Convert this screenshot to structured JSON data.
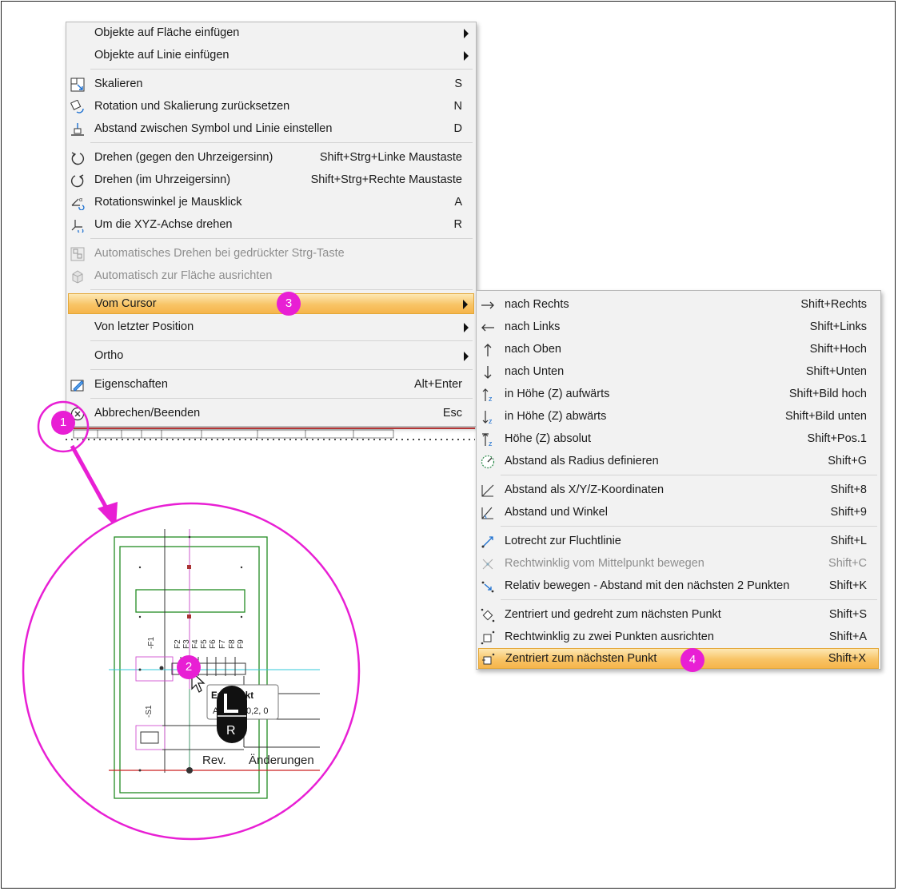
{
  "colors": {
    "menu_bg": "#f2f2f2",
    "highlight": "#f8c466",
    "badge": "#e81fd4",
    "disabled_text": "#8e8e8e"
  },
  "main_menu": {
    "items": [
      {
        "label": "Objekte auf Fläche einfügen",
        "shortcut": "",
        "icon": "none"
      },
      {
        "label": "Objekte auf Linie einfügen",
        "shortcut": "",
        "icon": "none"
      },
      {
        "label": "Skalieren",
        "shortcut": "S",
        "icon": "scale-icon"
      },
      {
        "label": "Rotation und Skalierung zurücksetzen",
        "shortcut": "N",
        "icon": "reset-rotation-icon"
      },
      {
        "label": "Abstand zwischen Symbol und Linie einstellen",
        "shortcut": "D",
        "icon": "symbol-line-distance-icon"
      },
      {
        "label": "Drehen (gegen den Uhrzeigersinn)",
        "shortcut": "Shift+Strg+Linke Maustaste",
        "icon": "rotate-ccw-icon"
      },
      {
        "label": "Drehen (im Uhrzeigersinn)",
        "shortcut": "Shift+Strg+Rechte Maustaste",
        "icon": "rotate-cw-icon"
      },
      {
        "label": "Rotationswinkel je Mausklick",
        "shortcut": "A",
        "icon": "rotation-angle-icon"
      },
      {
        "label": "Um die XYZ-Achse drehen",
        "shortcut": "R",
        "icon": "xyz-rotate-icon"
      },
      {
        "label": "Automatisches Drehen bei gedrückter Strg-Taste",
        "shortcut": "",
        "icon": "auto-rotate-icon"
      },
      {
        "label": "Automatisch zur Fläche ausrichten",
        "shortcut": "",
        "icon": "align-surface-icon"
      },
      {
        "label": "Vom Cursor",
        "shortcut": "",
        "icon": "none"
      },
      {
        "label": "Von letzter Position",
        "shortcut": "",
        "icon": "none"
      },
      {
        "label": "Ortho",
        "shortcut": "",
        "icon": "none"
      },
      {
        "label": "Eigenschaften",
        "shortcut": "Alt+Enter",
        "icon": "properties-icon"
      },
      {
        "label": "Abbrechen/Beenden",
        "shortcut": "Esc",
        "icon": "cancel-icon"
      }
    ]
  },
  "sub_menu": {
    "items": [
      {
        "label": "nach Rechts",
        "shortcut": "Shift+Rechts",
        "icon": "arrow-right-icon"
      },
      {
        "label": "nach Links",
        "shortcut": "Shift+Links",
        "icon": "arrow-left-icon"
      },
      {
        "label": "nach Oben",
        "shortcut": "Shift+Hoch",
        "icon": "arrow-up-icon"
      },
      {
        "label": "nach Unten",
        "shortcut": "Shift+Unten",
        "icon": "arrow-down-icon"
      },
      {
        "label": "in Höhe (Z) aufwärts",
        "shortcut": "Shift+Bild hoch",
        "icon": "z-up-icon"
      },
      {
        "label": "in Höhe (Z) abwärts",
        "shortcut": "Shift+Bild unten",
        "icon": "z-down-icon"
      },
      {
        "label": "Höhe (Z) absolut",
        "shortcut": "Shift+Pos.1",
        "icon": "z-absolute-icon"
      },
      {
        "label": "Abstand als Radius definieren",
        "shortcut": "Shift+G",
        "icon": "radius-icon"
      },
      {
        "label": "Abstand als X/Y/Z-Koordinaten",
        "shortcut": "Shift+8",
        "icon": "xyz-coordinates-icon"
      },
      {
        "label": "Abstand und Winkel",
        "shortcut": "Shift+9",
        "icon": "distance-angle-icon"
      },
      {
        "label": "Lotrecht zur Fluchtlinie",
        "shortcut": "Shift+L",
        "icon": "perpendicular-icon"
      },
      {
        "label": "Rechtwinklig vom Mittelpunkt bewegen",
        "shortcut": "Shift+C",
        "icon": "orthogonal-center-icon"
      },
      {
        "label": "Relativ bewegen - Abstand mit den nächsten 2 Punkten",
        "shortcut": "Shift+K",
        "icon": "relative-move-icon"
      },
      {
        "label": "Zentriert und gedreht zum nächsten Punkt",
        "shortcut": "Shift+S",
        "icon": "centered-rotated-icon"
      },
      {
        "label": "Rechtwinklig zu zwei Punkten ausrichten",
        "shortcut": "Shift+A",
        "icon": "align-two-points-icon"
      },
      {
        "label": "Zentriert zum nächsten Punkt",
        "shortcut": "Shift+X",
        "icon": "centered-next-point-icon"
      }
    ]
  },
  "badges": [
    "1",
    "2",
    "3",
    "4"
  ],
  "zoom_view": {
    "labels": {
      "f1": "-F1",
      "f2": "F2",
      "f3": "F3",
      "f4": "F4",
      "f5": "F5",
      "f6": "F6",
      "f7": "F7",
      "f8": "F8",
      "f9": "F9",
      "s1": "-S1",
      "rev": "Rev.",
      "aenderungen": "Änderungen"
    },
    "tooltip": {
      "title": "Endpunkt",
      "coords": "0,2, 0",
      "prefix": "A"
    },
    "mouse_key": "R"
  }
}
